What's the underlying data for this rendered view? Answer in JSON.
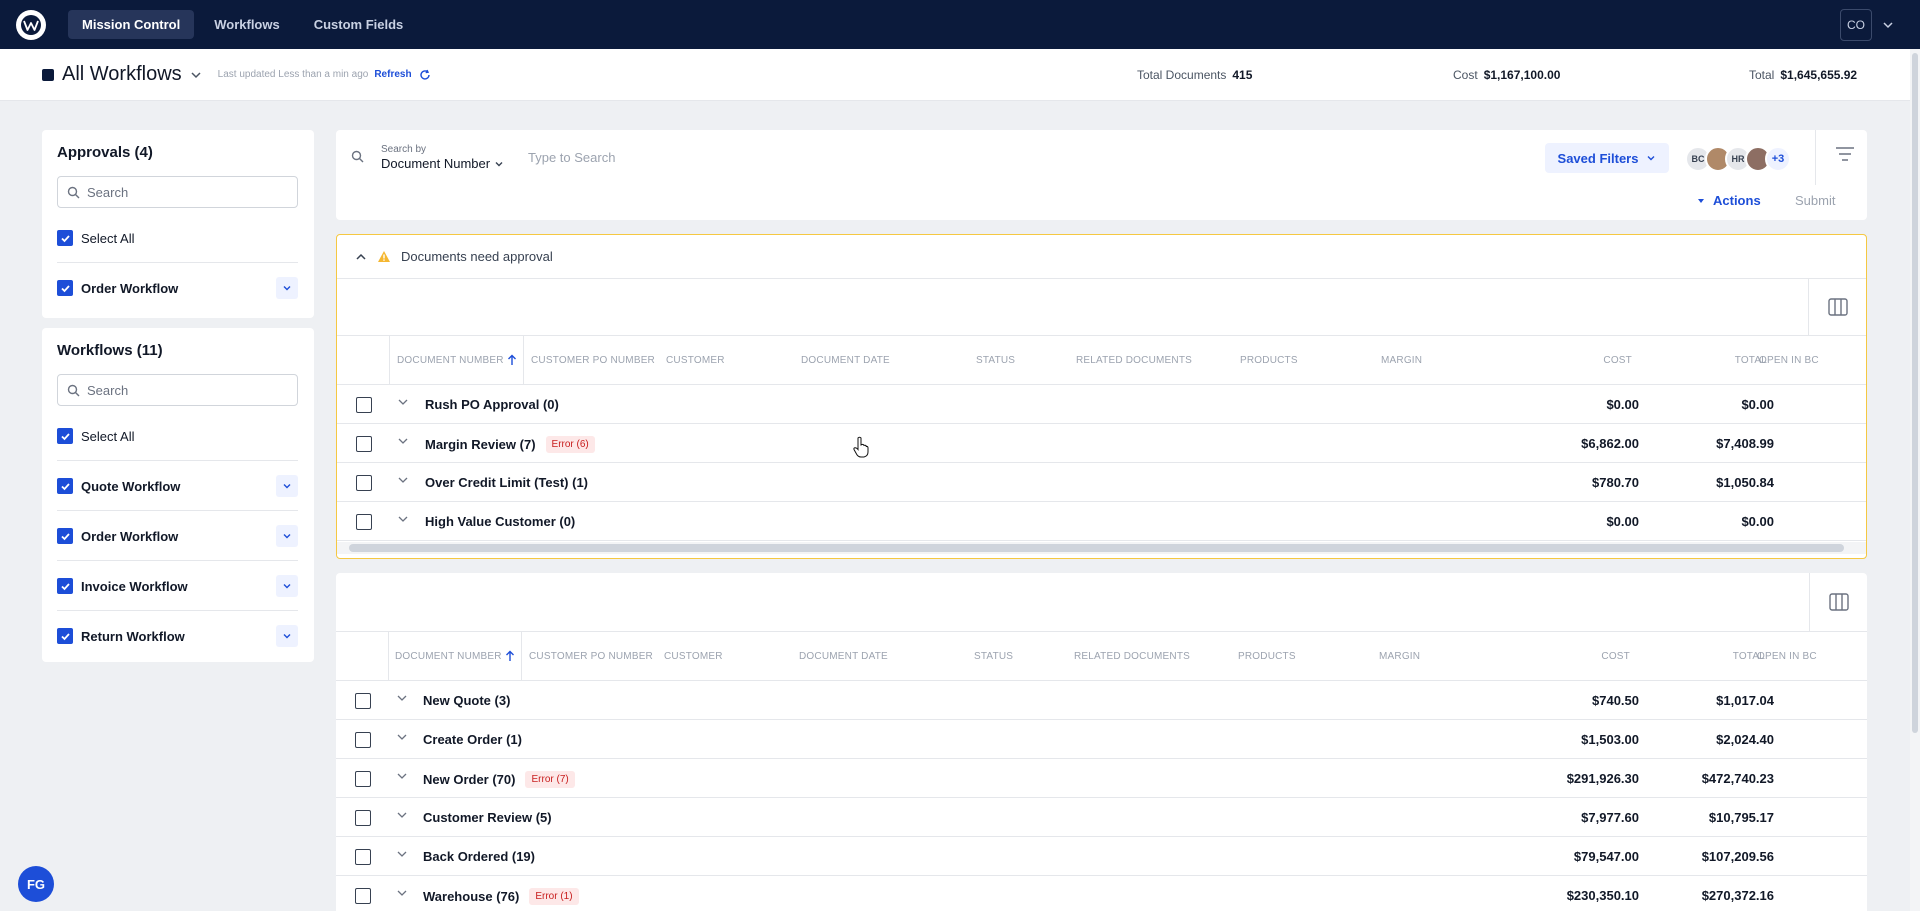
{
  "nav": {
    "items": [
      {
        "label": "Mission Control",
        "active": true
      },
      {
        "label": "Workflows",
        "active": false
      },
      {
        "label": "Custom Fields",
        "active": false
      }
    ],
    "user_initials": "CO"
  },
  "header": {
    "title": "All Workflows",
    "last_updated": "Last updated Less than a min ago",
    "refresh_label": "Refresh",
    "stats": {
      "total_documents_label": "Total Documents",
      "total_documents_value": "415",
      "cost_label": "Cost",
      "cost_value": "$1,167,100.00",
      "total_label": "Total",
      "total_value": "$1,645,655.92"
    }
  },
  "approvals": {
    "title": "Approvals (4)",
    "search_placeholder": "Search",
    "select_all": "Select All",
    "items": [
      "Order Workflow"
    ]
  },
  "workflows": {
    "title": "Workflows (11)",
    "search_placeholder": "Search",
    "select_all": "Select All",
    "items": [
      "Quote Workflow",
      "Order Workflow",
      "Invoice Workflow",
      "Return Workflow"
    ]
  },
  "toolbar": {
    "search_by_label": "Search by",
    "search_by_value": "Document Number",
    "search_placeholder": "Type to Search",
    "saved_filters": "Saved Filters",
    "avatars": [
      "BC",
      "HR"
    ],
    "more_avatars": "+3",
    "actions": "Actions",
    "submit": "Submit"
  },
  "columns": [
    "DOCUMENT NUMBER",
    "CUSTOMER PO NUMBER",
    "CUSTOMER",
    "DOCUMENT DATE",
    "STATUS",
    "RELATED DOCUMENTS",
    "PRODUCTS",
    "MARGIN",
    "COST",
    "TOTAL",
    "OPEN IN BC"
  ],
  "approval_table": {
    "banner": "Documents need approval",
    "rows": [
      {
        "name": "Rush PO Approval (0)",
        "badge": "",
        "cost": "$0.00",
        "total": "$0.00"
      },
      {
        "name": "Margin Review (7)",
        "badge": "Error (6)",
        "cost": "$6,862.00",
        "total": "$7,408.99"
      },
      {
        "name": "Over Credit Limit (Test) (1)",
        "badge": "",
        "cost": "$780.70",
        "total": "$1,050.84"
      },
      {
        "name": "High Value Customer (0)",
        "badge": "",
        "cost": "$0.00",
        "total": "$0.00"
      }
    ]
  },
  "workflow_table": {
    "rows": [
      {
        "name": "New Quote (3)",
        "badge": "",
        "cost": "$740.50",
        "total": "$1,017.04"
      },
      {
        "name": "Create Order (1)",
        "badge": "",
        "cost": "$1,503.00",
        "total": "$2,024.40"
      },
      {
        "name": "New Order (70)",
        "badge": "Error (7)",
        "cost": "$291,926.30",
        "total": "$472,740.23"
      },
      {
        "name": "Customer Review (5)",
        "badge": "",
        "cost": "$7,977.60",
        "total": "$10,795.17"
      },
      {
        "name": "Back Ordered (19)",
        "badge": "",
        "cost": "$79,547.00",
        "total": "$107,209.56"
      },
      {
        "name": "Warehouse (76)",
        "badge": "Error (1)",
        "cost": "$230,350.10",
        "total": "$270,372.16"
      }
    ]
  },
  "fab_initials": "FG",
  "colors": {
    "nav_bg": "#0b1a3b",
    "accent": "#1d4ed8",
    "error": "#c81e1e",
    "warning": "#f5c842"
  }
}
